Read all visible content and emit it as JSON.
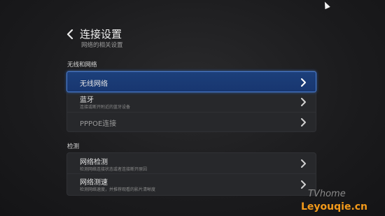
{
  "header": {
    "title": "连接设置",
    "subtitle": "网络的相关设置"
  },
  "sections": [
    {
      "title": "无线和网络",
      "items": [
        {
          "label": "无线网络",
          "desc": ""
        },
        {
          "label": "蓝牙",
          "desc": "连接或断开附近的蓝牙设备"
        },
        {
          "label": "PPPOE连接",
          "desc": ""
        }
      ]
    },
    {
      "title": "检测",
      "items": [
        {
          "label": "网络检测",
          "desc": "检测网络连接状态或者连接断开原因"
        },
        {
          "label": "网络测速",
          "desc": "检测网络速度，并推荐观看的影片清晰度"
        }
      ]
    }
  ],
  "watermark": {
    "line1": "TVhome",
    "line2": "Leyouqie.cn"
  },
  "colors": {
    "selected_bg": "#1c3f7a",
    "selected_border": "#4d7fd0",
    "panel_bg": "#27282b",
    "watermark_orange": "#f39a1a",
    "watermark_red": "#e53a1c",
    "watermark_green": "#3aa236"
  }
}
